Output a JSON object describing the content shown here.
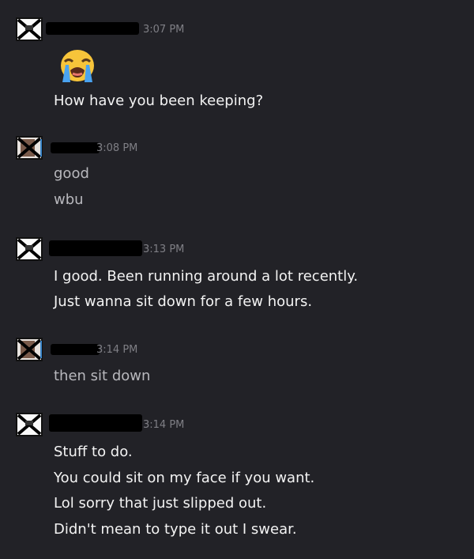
{
  "messages": [
    {
      "time": "3:07 PM",
      "emoji": "loudly-crying-face",
      "lines": [
        "How have you been keeping?"
      ]
    },
    {
      "time": "3:08 PM",
      "lines": [
        "good",
        "wbu"
      ]
    },
    {
      "time": "3:13 PM",
      "lines": [
        "I good. Been running around a lot recently.",
        "Just wanna sit down for a few hours."
      ]
    },
    {
      "time": "3:14 PM",
      "lines": [
        "then sit down"
      ]
    },
    {
      "time": "3:14 PM",
      "lines": [
        "Stuff to do.",
        "You could sit on my face if you want.",
        "Lol sorry that just slipped out.",
        "Didn't mean to type it out I swear."
      ]
    }
  ],
  "colors": {
    "background": "#222227",
    "text_primary": "#f3f3f3",
    "text_secondary": "#b8b8bd",
    "timestamp": "#7f7f85",
    "redaction": "#000000"
  }
}
